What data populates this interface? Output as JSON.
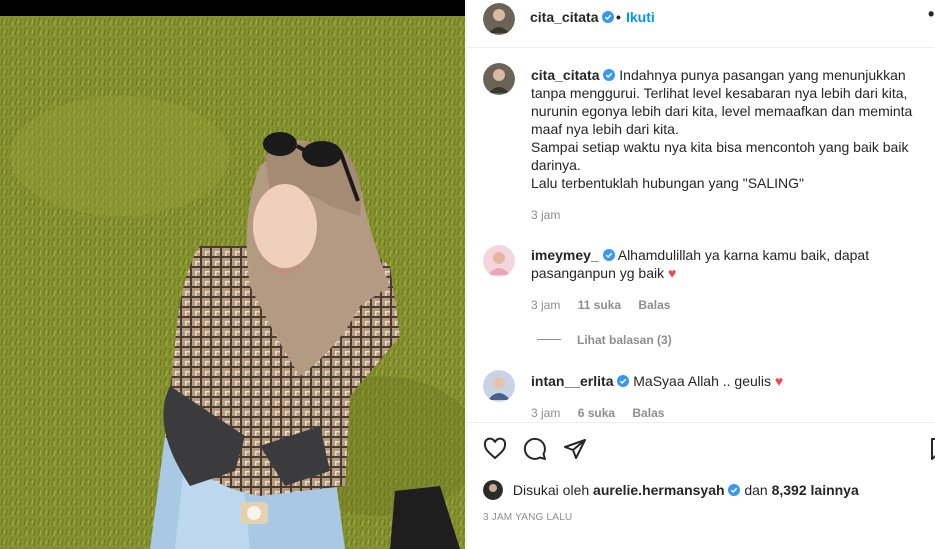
{
  "post": {
    "author": "cita_citata",
    "separator": "•",
    "follow_label": "Ikuti",
    "more_label": "•"
  },
  "caption": {
    "username": "cita_citata",
    "lines": [
      "Indahnya punya pasangan yang menunjukkan",
      "tanpa menggurui. Terlihat level kesabaran nya lebih dari kita,",
      "nurunin egonya lebih dari kita, level memaafkan dan meminta",
      "maaf nya lebih dari kita.",
      "Sampai setiap waktu nya kita bisa mencontoh yang baik baik",
      "darinya.",
      "Lalu terbentuklah hubungan yang \"SALING\""
    ],
    "time": "3 jam"
  },
  "comments": [
    {
      "username": "imeymey_",
      "text_line1": "Alhamdulillah ya karna kamu baik, dapat",
      "text_line2": "pasanganpun yg baik",
      "heart": "♥",
      "time": "3 jam",
      "likes": "11 suka",
      "reply": "Balas",
      "view_replies": "Lihat balasan (3)"
    },
    {
      "username": "intan__erlita",
      "text": "MaSyaa Allah .. geulis",
      "heart": "♥",
      "time": "3 jam",
      "likes": "6 suka",
      "reply": "Balas"
    }
  ],
  "likes": {
    "prefix": "Disukai oleh",
    "user": "aurelie.hermansyah",
    "conj": "dan",
    "count": "8,392 lainnya"
  },
  "timestamp": "3 JAM YANG LALU",
  "icons": {
    "like": "heart-icon",
    "comment": "comment-icon",
    "share": "paper-plane-icon",
    "save": "bookmark-icon",
    "verified": "verified-badge-icon"
  },
  "colors": {
    "link_blue": "#0095f6",
    "verified_blue": "#3897f0",
    "heart_red": "#ed4956",
    "muted": "#8e8e8e"
  }
}
